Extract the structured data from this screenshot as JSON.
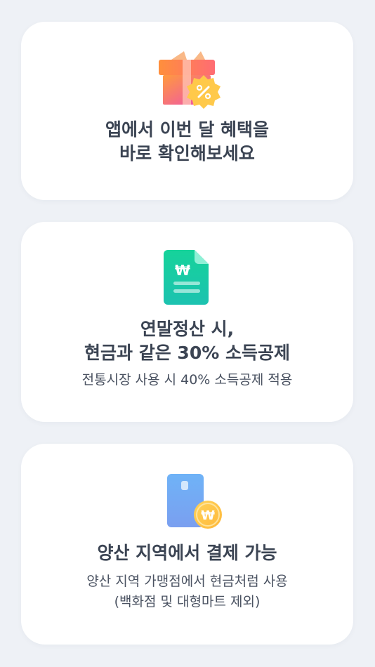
{
  "cards": [
    {
      "icon": "gift-percent-icon",
      "title_lines": [
        "앱에서 이번 달 혜택을",
        "바로 확인해보세요"
      ],
      "sub_lines": []
    },
    {
      "icon": "won-document-icon",
      "title_lines": [
        "연말정산 시,",
        "현금과 같은 30% 소득공제"
      ],
      "sub_lines": [
        "전통시장 사용 시 40% 소득공제 적용"
      ]
    },
    {
      "icon": "won-card-icon",
      "title_lines": [
        "양산 지역에서 결제 가능"
      ],
      "sub_lines": [
        "양산 지역 가맹점에서 현금처럼 사용",
        "(백화점 및 대형마트 제외)"
      ]
    }
  ],
  "colors": {
    "background": "#eef1f6",
    "card": "#ffffff",
    "text": "#3b4453",
    "gift_pink": "#f25fa8",
    "gift_orange": "#ff8a4a",
    "badge_yellow": "#ffc94a",
    "doc_teal": "#19c9a3",
    "card_blue": "#78b4f5"
  }
}
